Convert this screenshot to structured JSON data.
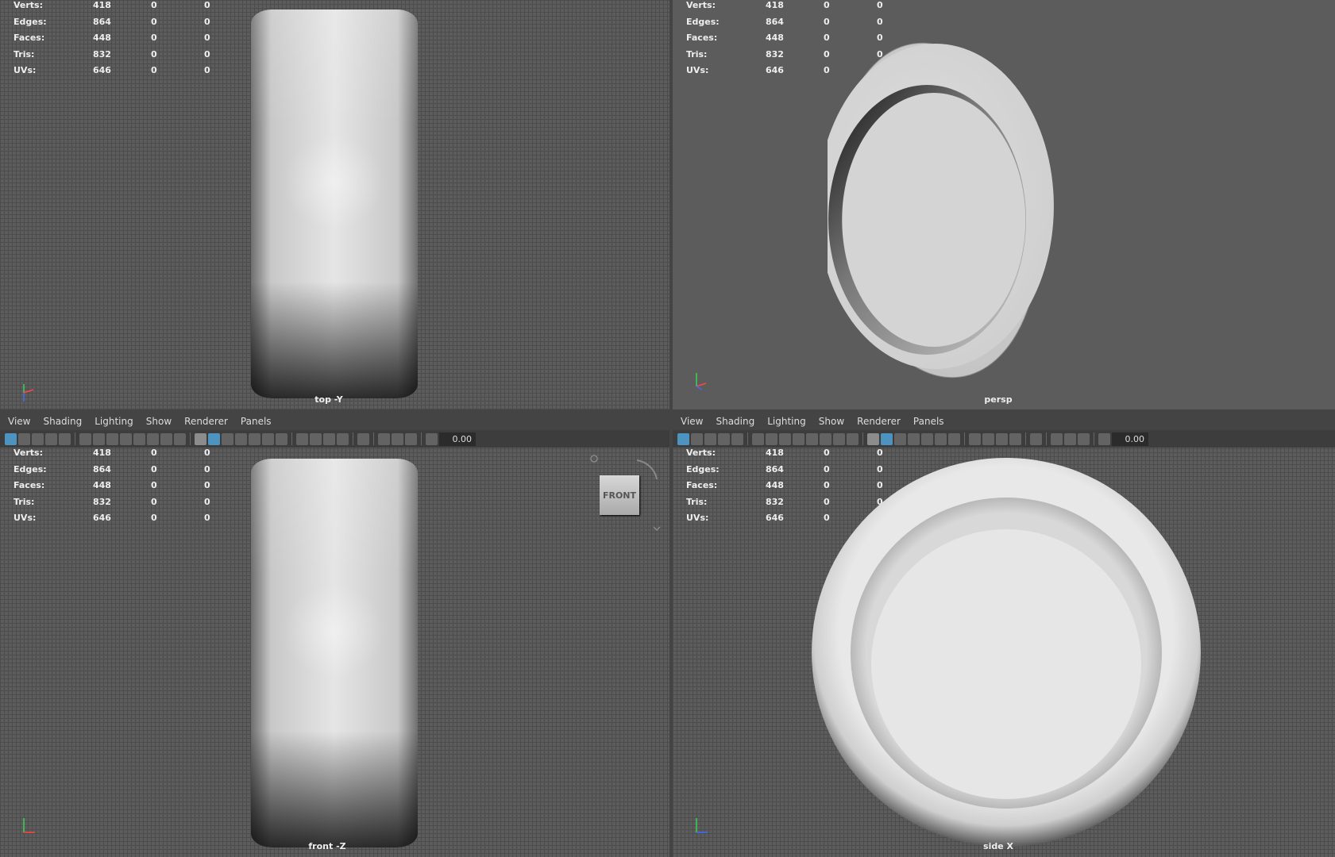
{
  "stats": [
    {
      "label": "Verts:",
      "v1": "418",
      "v2": "0",
      "v3": "0"
    },
    {
      "label": "Edges:",
      "v1": "864",
      "v2": "0",
      "v3": "0"
    },
    {
      "label": "Faces:",
      "v1": "448",
      "v2": "0",
      "v3": "0"
    },
    {
      "label": "Tris:",
      "v1": "832",
      "v2": "0",
      "v3": "0"
    },
    {
      "label": "UVs:",
      "v1": "646",
      "v2": "0",
      "v3": "0"
    }
  ],
  "menu": {
    "view": "View",
    "shading": "Shading",
    "lighting": "Lighting",
    "show": "Show",
    "renderer": "Renderer",
    "panels": "Panels"
  },
  "toolbar_value": "0.00",
  "cameras": {
    "top": "top -Y",
    "persp": "persp",
    "front": "front -Z",
    "side": "side X"
  },
  "viewcube_label": "FRONT",
  "colors": {
    "background": "#5c5c5c",
    "grid": "#4c4c4c",
    "selected_tool": "#4fa3d6"
  }
}
